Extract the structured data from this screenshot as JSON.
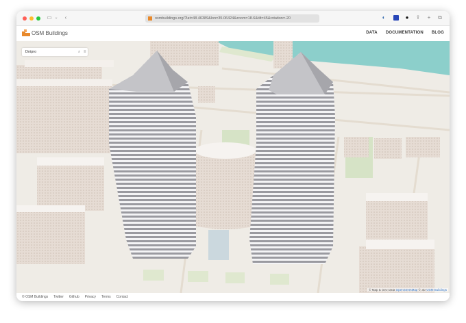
{
  "browser": {
    "url": "osmbuildings.org/?lat=48.46389&lon=35.06424&zoom=18.6&tilt=45&rotation=-20"
  },
  "header": {
    "brand": "OSM Buildings",
    "nav": [
      "DATA",
      "DOCUMENTATION",
      "BLOG"
    ]
  },
  "search": {
    "value": "Dnipro"
  },
  "attribution": {
    "prefix": "© Map & Geo Data",
    "osm": "OpenStreetMap",
    "mid": "© 3D",
    "osmb": "OSM Buildings"
  },
  "footer": {
    "links": [
      "© OSM Buildings",
      "Twitter",
      "Github",
      "Privacy",
      "Terms",
      "Contact"
    ]
  },
  "colors": {
    "water": "#8ccfcb",
    "ground": "#efece6",
    "accent": "#e8892b"
  }
}
